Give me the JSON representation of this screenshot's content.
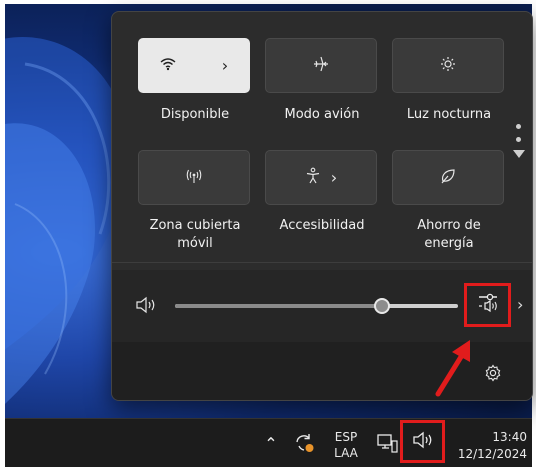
{
  "quick_settings": {
    "tiles": [
      {
        "label": "Disponible",
        "icon": "wifi-icon",
        "active": true,
        "has_chevron": true
      },
      {
        "label": "Modo avión",
        "icon": "airplane-icon",
        "active": false,
        "has_chevron": false
      },
      {
        "label": "Luz nocturna",
        "icon": "night-light-icon",
        "active": false,
        "has_chevron": false
      },
      {
        "label": "Zona cubierta móvil",
        "label_line1": "Zona cubierta",
        "label_line2": "móvil",
        "icon": "mobile-hotspot-icon",
        "active": false,
        "has_chevron": false
      },
      {
        "label": "Accesibilidad",
        "icon": "accessibility-icon",
        "active": false,
        "has_chevron": true
      },
      {
        "label": "Ahorro de energía",
        "label_line1": "Ahorro de",
        "label_line2": "energía",
        "icon": "energy-saver-icon",
        "active": false,
        "has_chevron": false
      }
    ],
    "chevron": "›",
    "pager_icon": "pager-dots-icon",
    "volume": {
      "icon": "speaker-icon",
      "level_fraction": 0.73,
      "output_icon": "audio-output-select-icon",
      "chevron": "›"
    },
    "settings_icon": "gear-icon"
  },
  "taskbar": {
    "chevron_up": "⌃",
    "sync_icon": "sync-icon",
    "lang_line1": "ESP",
    "lang_line2": "LAA",
    "network_icon": "network-icon",
    "volume_icon": "speaker-icon",
    "time": "13:40",
    "date": "12/12/2024"
  },
  "colors": {
    "highlight_red": "#e11c1c",
    "flyout_bg": "#2c2c2c",
    "active_tile": "#e9e9e9"
  }
}
